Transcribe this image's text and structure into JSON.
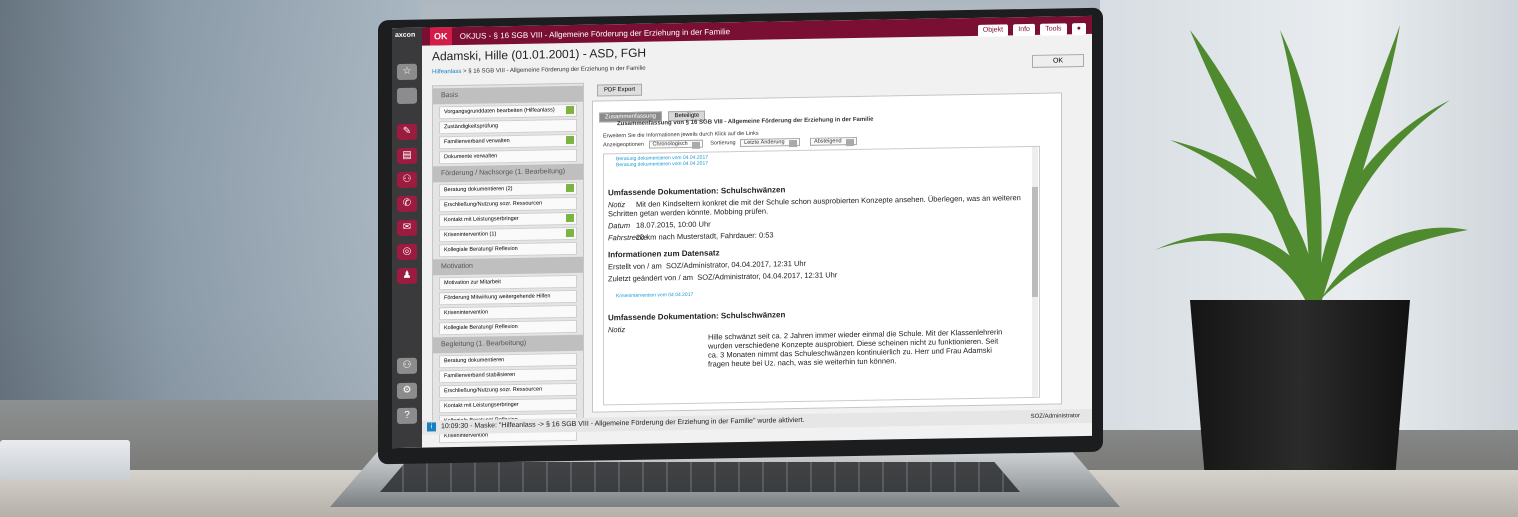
{
  "window": {
    "logo": "axcon",
    "ok_badge": "OK",
    "title": "OKJUS - § 16 SGB VIII - Allgemeine Förderung der Erziehung in der Familie",
    "buttons": [
      "Objekt",
      "Info",
      "Tools"
    ]
  },
  "header": {
    "person": "Adamski, Hille (01.01.2001) - ASD, FGH",
    "breadcrumb_link": "Hilfeanlass",
    "breadcrumb_rest": " > § 16 SGB VIII - Allgemeine Förderung der Erziehung in der Familie",
    "ok_button": "OK"
  },
  "sidebar": {
    "sections": [
      {
        "title": "Basis",
        "items": [
          {
            "label": "Vorgangsgrunddaten bearbeiten (Hilfeanlass)",
            "checked": true
          },
          {
            "label": "Zuständigkeitsprüfung",
            "checked": false
          },
          {
            "label": "Familienverband verwalten",
            "checked": true
          },
          {
            "label": "Dokumente verwalten",
            "checked": false
          }
        ]
      },
      {
        "title": "Förderung / Nachsorge (1. Bearbeitung)",
        "items": [
          {
            "label": "Beratung dokumentieren (2)",
            "checked": true
          },
          {
            "label": "Erschließung/Nutzung sozr. Ressourcen",
            "checked": false
          },
          {
            "label": "Kontakt mit Leistungserbringer",
            "checked": true
          },
          {
            "label": "Krisenintervention (1)",
            "checked": true
          },
          {
            "label": "Kollegiale Beratung/ Reflexion",
            "checked": false
          }
        ]
      },
      {
        "title": "Motivation",
        "items": [
          {
            "label": "Motivation zur Mitarbeit",
            "checked": false
          },
          {
            "label": "Förderung Mitwirkung weitergehende Hilfen",
            "checked": false
          },
          {
            "label": "Krisenintervention",
            "checked": false
          },
          {
            "label": "Kollegiale Beratung/ Reflexion",
            "checked": false
          }
        ]
      },
      {
        "title": "Begleitung (1. Bearbeitung)",
        "items": [
          {
            "label": "Beratung dokumentieren",
            "checked": false
          },
          {
            "label": "Familienverband stabilisieren",
            "checked": false
          },
          {
            "label": "Erschließung/Nutzung sozr. Ressourcen",
            "checked": false
          },
          {
            "label": "Kontakt mit Leistungserbringer",
            "checked": false
          },
          {
            "label": "Kollegiale Beratung/ Reflexion",
            "checked": false
          },
          {
            "label": "Krisenintervention",
            "checked": false
          }
        ]
      }
    ]
  },
  "content": {
    "pdf_button": "PDF Export",
    "tabs": [
      "Zusammenfassung",
      "Beteiligte"
    ],
    "group_title": "Zusammenfassung von § 16 SGB VIII - Allgemeine Förderung der Erziehung in der Familie",
    "hint": "Erweitern Sie die Informationen jeweils durch Klick auf die Links",
    "sort": {
      "label_display": "Anzeigeoptionen",
      "display_value": "Chronologisch",
      "label_sort": "Sortierung",
      "sort_value": "Letzte Änderung",
      "order_value": "Absteigend"
    },
    "links": [
      "Beratung dokumentieren vom 04.04.2017",
      "Beratung dokumentieren vom 04.04.2017",
      "Krisenintervention vom 04.04.2017"
    ],
    "doc1": {
      "heading": "Umfassende Dokumentation: Schulschwänzen",
      "notiz_label": "Notiz",
      "notiz": "Mit den Kindseltern konkret die mit der Schule schon ausprobierten Konzepte ansehen. Überlegen, was an weiteren Schritten getan werden könnte. Mobbing prüfen.",
      "datum_label": "Datum",
      "datum": "18.07.2015, 10:00 Uhr",
      "fahrt_label": "Fahrstrecke",
      "fahrt": "20 km nach Musterstadt, Fahrdauer: 0:53"
    },
    "meta": {
      "heading": "Informationen zum Datensatz",
      "created_label": "Erstellt von / am",
      "created": "SOZ/Administrator, 04.04.2017, 12:31 Uhr",
      "changed_label": "Zuletzt geändert von / am",
      "changed": "SOZ/Administrator, 04.04.2017, 12:31 Uhr"
    },
    "doc2": {
      "heading": "Umfassende Dokumentation: Schulschwänzen",
      "notiz_label": "Notiz",
      "notiz": "Hille schwänzt seit ca. 2 Jahren immer wieder einmal die Schule. Mit der Klassenlehrerin wurden verschiedene Konzepte ausprobiert. Diese scheinen nicht zu funktionieren. Seit ca. 3 Monaten nimmt das Schuleschwänzen kontinuierlich zu. Herr und Frau Adamski fragen heute bei Uz. nach, was sie weiterhin tun können."
    }
  },
  "status": {
    "message": "10:09:30 - Maske: \"Hilfeanlass -> § 16 SGB VIII - Allgemeine Förderung der Erziehung in der Familie\" wurde aktiviert.",
    "user": "SOZ/Administrator"
  },
  "colors": {
    "title_bar": "#7a0f33",
    "accent": "#d31c48",
    "link": "#1a9bd6"
  }
}
